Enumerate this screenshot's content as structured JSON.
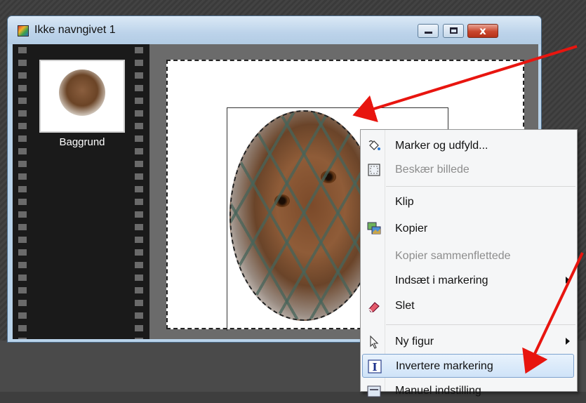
{
  "window": {
    "title": "Ikke navngivet 1",
    "controls": {
      "minimize": "minimize",
      "maximize": "maximize",
      "close": "x"
    }
  },
  "layers": [
    {
      "label": "Baggrund"
    }
  ],
  "context_menu": {
    "items": [
      {
        "label": "Marker og udfyld...",
        "icon": "paint-bucket-icon",
        "enabled": true
      },
      {
        "label": "Beskær billede",
        "icon": "crop-selection-icon",
        "enabled": false
      },
      {
        "label": "Klip",
        "icon": "",
        "enabled": true
      },
      {
        "label": "Kopier",
        "icon": "copy-images-icon",
        "enabled": true
      },
      {
        "label": "Kopier sammenflettede",
        "icon": "",
        "enabled": false
      },
      {
        "label": "Indsæt i markering",
        "icon": "",
        "enabled": true,
        "submenu": true
      },
      {
        "label": "Slet",
        "icon": "eraser-icon",
        "enabled": true
      },
      {
        "label": "Ny figur",
        "icon": "pointer-icon",
        "enabled": true,
        "submenu": true
      },
      {
        "label": "Invertere markering",
        "icon": "invert-selection-icon",
        "enabled": true,
        "highlighted": true
      },
      {
        "label": "Manuel indstilling",
        "icon": "manual-setting-icon",
        "enabled": true
      }
    ]
  },
  "colors": {
    "highlight": "#cfe3f8",
    "annotation_arrow": "#e8150f",
    "title_bar": "#bcd3ea",
    "close_button": "#c9462c"
  }
}
